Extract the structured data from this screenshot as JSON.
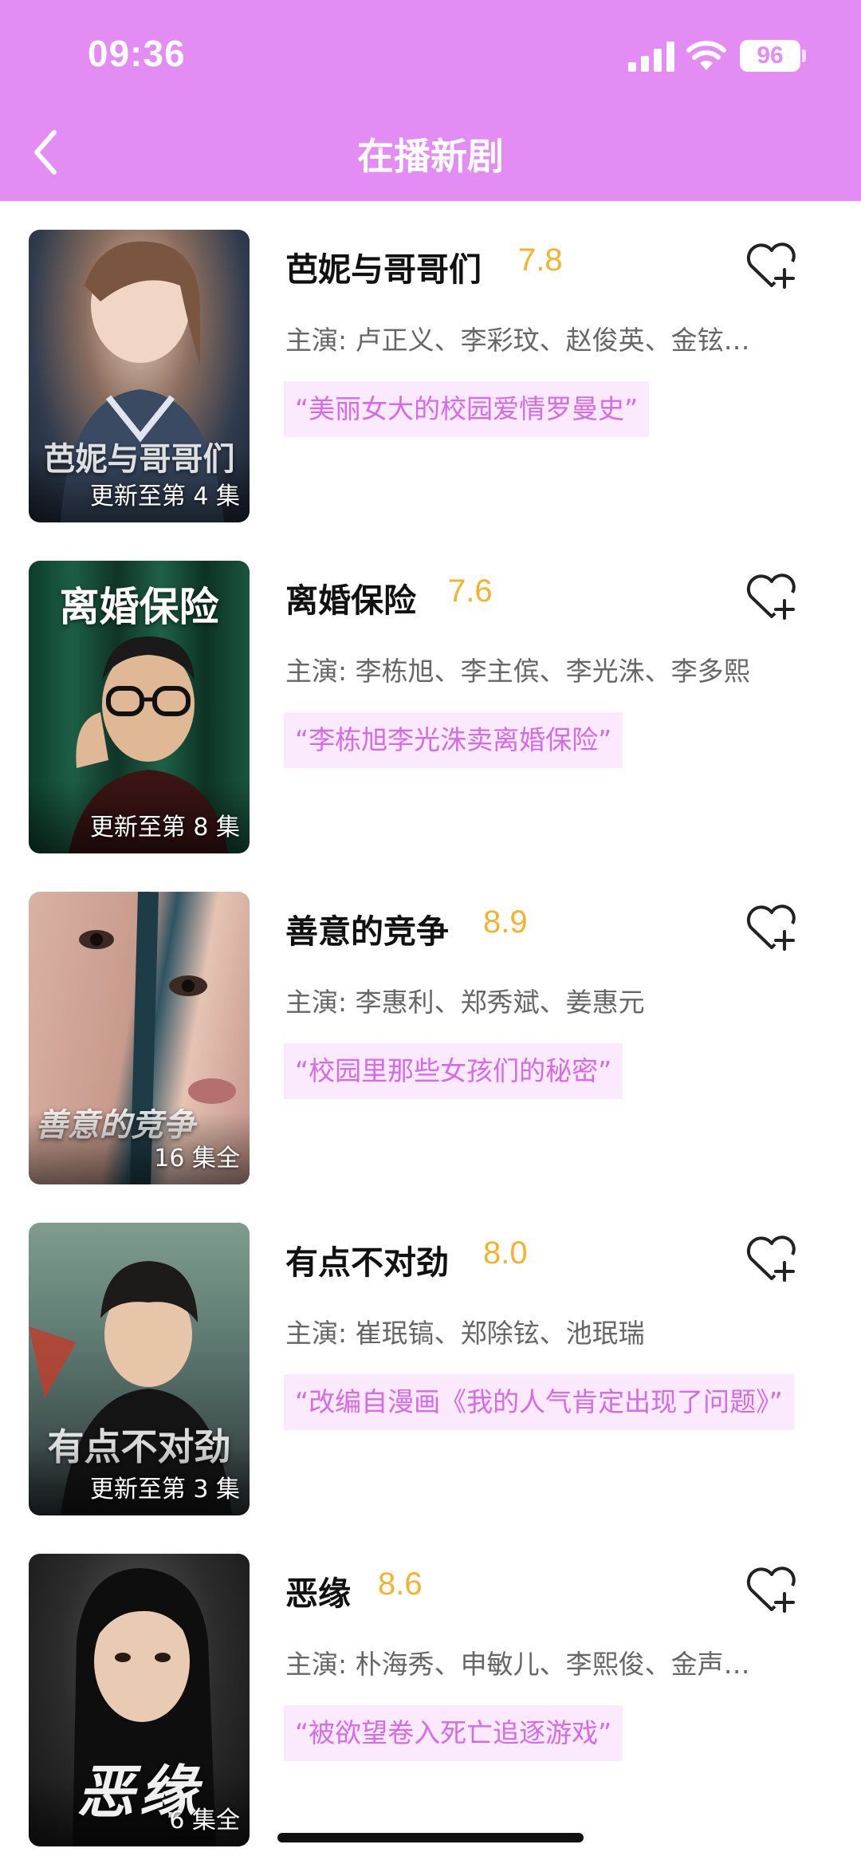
{
  "status_bar": {
    "time": "09:36",
    "battery": "96"
  },
  "nav": {
    "title": "在播新剧",
    "back_icon": "chevron-left-icon"
  },
  "colors": {
    "header": "#e38cf3",
    "score": "#f3b330",
    "quote_text": "#d56be6",
    "quote_bg": "#fbeafd"
  },
  "dramas": [
    {
      "title": "芭妮与哥哥们",
      "score": "7.8",
      "cast": "主演: 卢正义、李彩玟、赵俊英、金铉…",
      "quote": "“美丽女大的校园爱情罗曼史”",
      "badge": "更新至第 4 集",
      "poster_text": "芭妮与哥哥们"
    },
    {
      "title": "离婚保险",
      "score": "7.6",
      "cast": "主演: 李栋旭、李主傧、李光洙、李多熙",
      "quote": "“李栋旭李光洙卖离婚保险”",
      "badge": "更新至第 8 集",
      "poster_text": "离婚保险"
    },
    {
      "title": "善意的竞争",
      "score": "8.9",
      "cast": "主演: 李惠利、郑秀斌、姜惠元",
      "quote": "“校园里那些女孩们的秘密”",
      "badge": "16 集全",
      "poster_text": "善意的竞争"
    },
    {
      "title": "有点不对劲",
      "score": "8.0",
      "cast": "主演: 崔珉镐、郑除铉、池珉瑞",
      "quote": "“改编自漫画《我的人气肯定出现了问题》”",
      "badge": "更新至第 3 集",
      "poster_text": "有点不对劲"
    },
    {
      "title": "恶缘",
      "score": "8.6",
      "cast": "主演: 朴海秀、申敏儿、李熙俊、金声…",
      "quote": "“被欲望卷入死亡追逐游戏”",
      "badge": "6 集全",
      "poster_text": "恶缘"
    }
  ]
}
